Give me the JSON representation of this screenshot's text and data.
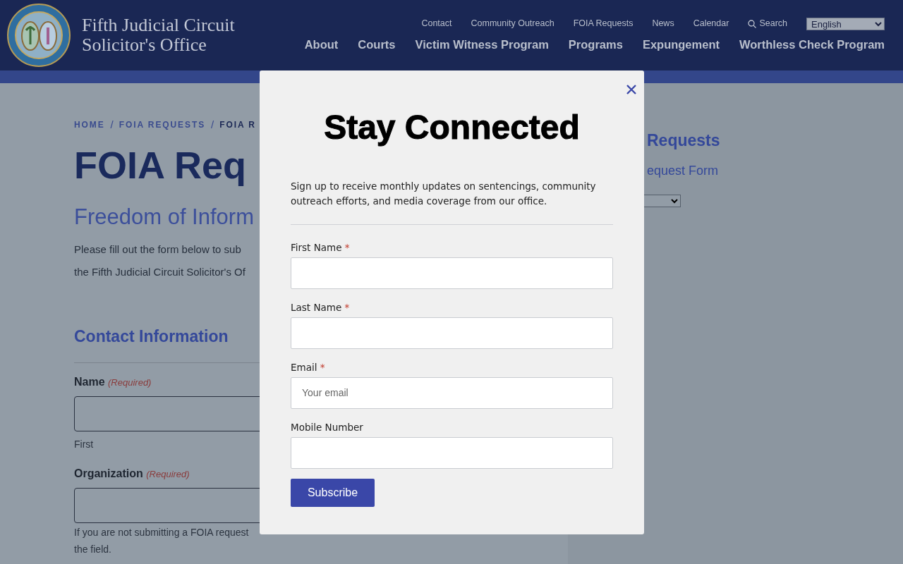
{
  "header": {
    "logo_lines": [
      "Fifth Judicial Circuit",
      "Solicitor's Office"
    ],
    "utility_links": [
      "Contact",
      "Community Outreach",
      "FOIA Requests",
      "News",
      "Calendar"
    ],
    "search_label": "Search",
    "language": "English",
    "main_nav": [
      "About",
      "Courts",
      "Victim Witness Program",
      "Programs",
      "Expungement",
      "Worthless Check Program"
    ]
  },
  "page": {
    "breadcrumb": [
      {
        "kind": "link",
        "label": "HOME",
        "current": false
      },
      {
        "kind": "separator",
        "label": "/"
      },
      {
        "kind": "link",
        "label": "FOIA REQUESTS",
        "current": false
      },
      {
        "kind": "separator",
        "label": "/"
      },
      {
        "kind": "link",
        "label": "FOIA R",
        "current": true
      }
    ],
    "title": "FOIA Req",
    "subtitle": "Freedom of Inform",
    "intro_lines": [
      "Please fill out the form below to sub",
      "the Fifth Judicial Circuit Solicitor's Of"
    ],
    "section_title": "Contact Information",
    "fields": [
      {
        "label": "Name",
        "note": "(Required)",
        "sublabel": "First"
      },
      {
        "label": "Organization",
        "note": "(Required)",
        "help_lines": [
          "If you are not submitting a FOIA request",
          "the field."
        ]
      }
    ]
  },
  "sidebar": {
    "title": "Requests",
    "link": "equest Form"
  },
  "modal": {
    "title": "Stay Connected",
    "description": "Sign up to receive monthly updates on sentencings, community outreach efforts, and media coverage from our office.",
    "fields": [
      {
        "label": "First Name",
        "required_mark": "*"
      },
      {
        "label": "Last Name",
        "required_mark": "*"
      },
      {
        "label": "Email",
        "required_mark": "*",
        "placeholder": "Your email"
      },
      {
        "label": "Mobile Number"
      }
    ],
    "submit": "Subscribe"
  }
}
